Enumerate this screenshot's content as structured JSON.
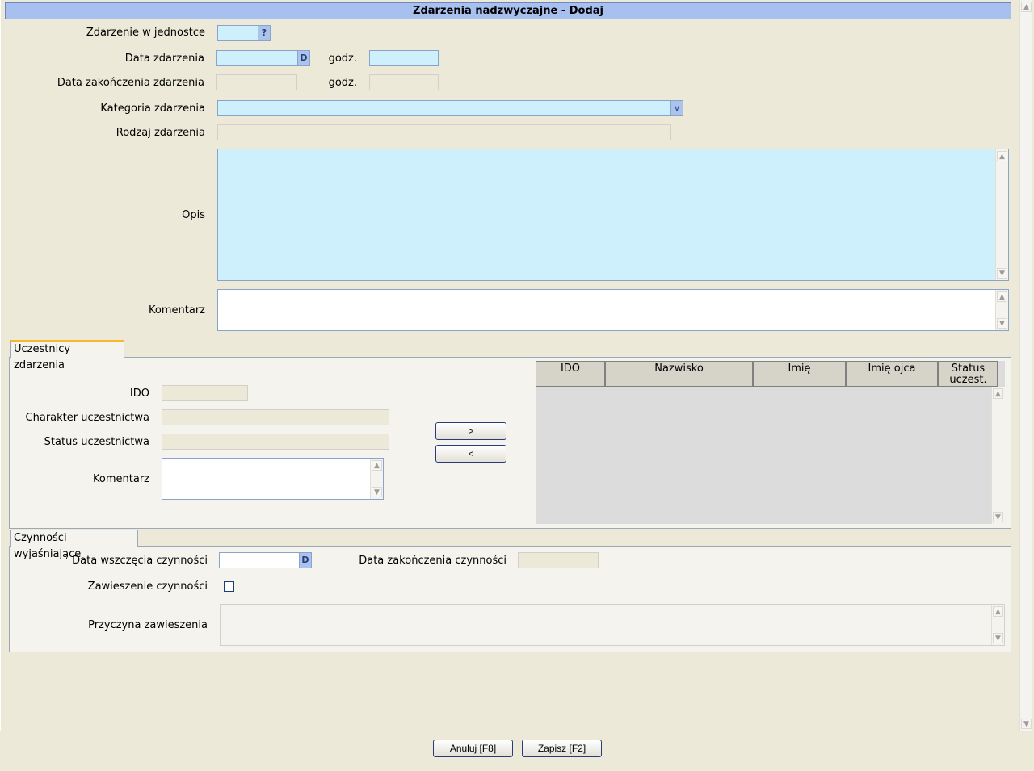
{
  "window_title": "Zdarzenia nadzwyczajne - Dodaj",
  "form": {
    "unit_label": "Zdarzenie w jednostce",
    "unit_button": "?",
    "event_date_label": "Data zdarzenia",
    "date_button": "D",
    "time_label": "godz.",
    "end_date_label": "Data zakończenia zdarzenia",
    "end_time_label": "godz.",
    "category_label": "Kategoria zdarzenia",
    "category_dropdown": "v",
    "type_label": "Rodzaj zdarzenia",
    "description_label": "Opis",
    "comment_label": "Komentarz"
  },
  "participants": {
    "tab_label": "Uczestnicy zdarzenia",
    "ido_label": "IDO",
    "character_label": "Charakter uczestnictwa",
    "status_label": "Status uczestnictwa",
    "comment_label": "Komentarz",
    "add_button": ">",
    "remove_button": "<",
    "columns": [
      "IDO",
      "Nazwisko",
      "Imię",
      "Imię ojca",
      "Status\nuczest."
    ]
  },
  "actions": {
    "tab_label": "Czynności wyjaśniające",
    "start_label": "Data wszczęcia czynności",
    "date_button": "D",
    "end_label": "Data zakończenia czynności",
    "suspend_label": "Zawieszenie czynności",
    "suspend_reason_label": "Przyczyna zawieszenia"
  },
  "footer": {
    "cancel_label": "Anuluj [F8]",
    "save_label": "Zapisz [F2]"
  }
}
